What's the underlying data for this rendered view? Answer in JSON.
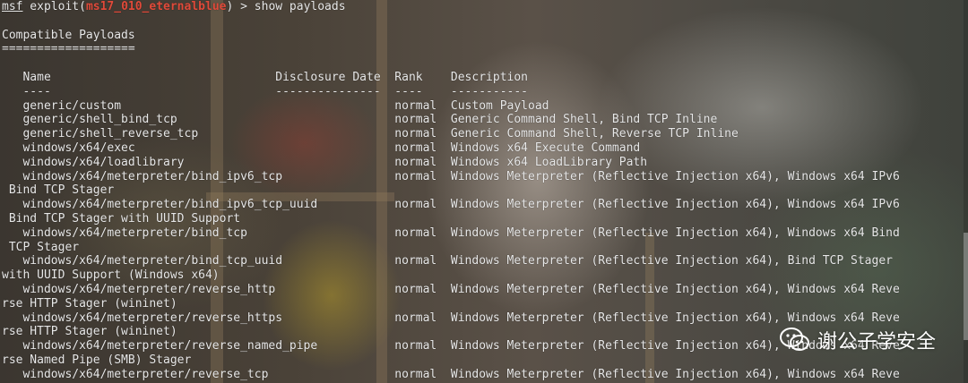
{
  "prompt": {
    "prefix": "msf",
    "middle": " exploit(",
    "module": "ms17_010_eternalblue",
    "suffix": ") > show payloads"
  },
  "lines": [
    "",
    "Compatible Payloads",
    "===================",
    "",
    "   Name                                Disclosure Date  Rank    Description",
    "   ----                                ---------------  ----    -----------",
    "   generic/custom                                       normal  Custom Payload",
    "   generic/shell_bind_tcp                               normal  Generic Command Shell, Bind TCP Inline",
    "   generic/shell_reverse_tcp                            normal  Generic Command Shell, Reverse TCP Inline",
    "   windows/x64/exec                                     normal  Windows x64 Execute Command",
    "   windows/x64/loadlibrary                              normal  Windows x64 LoadLibrary Path",
    "   windows/x64/meterpreter/bind_ipv6_tcp                normal  Windows Meterpreter (Reflective Injection x64), Windows x64 IPv6",
    " Bind TCP Stager",
    "   windows/x64/meterpreter/bind_ipv6_tcp_uuid           normal  Windows Meterpreter (Reflective Injection x64), Windows x64 IPv6",
    " Bind TCP Stager with UUID Support",
    "   windows/x64/meterpreter/bind_tcp                     normal  Windows Meterpreter (Reflective Injection x64), Windows x64 Bind",
    " TCP Stager",
    "   windows/x64/meterpreter/bind_tcp_uuid                normal  Windows Meterpreter (Reflective Injection x64), Bind TCP Stager",
    "with UUID Support (Windows x64)",
    "   windows/x64/meterpreter/reverse_http                 normal  Windows Meterpreter (Reflective Injection x64), Windows x64 Reve",
    "rse HTTP Stager (wininet)",
    "   windows/x64/meterpreter/reverse_https                normal  Windows Meterpreter (Reflective Injection x64), Windows x64 Reve",
    "rse HTTP Stager (wininet)",
    "   windows/x64/meterpreter/reverse_named_pipe           normal  Windows Meterpreter (Reflective Injection x64), Windows x64 Reve",
    "rse Named Pipe (SMB) Stager",
    "   windows/x64/meterpreter/reverse_tcp                  normal  Windows Meterpreter (Reflective Injection x64), Windows x64 Reve"
  ],
  "watermark": {
    "icon": "wechat-icon",
    "text": "谢公子学安全"
  },
  "colors": {
    "text": "#e8e8e8",
    "module": "#e04a3a"
  }
}
